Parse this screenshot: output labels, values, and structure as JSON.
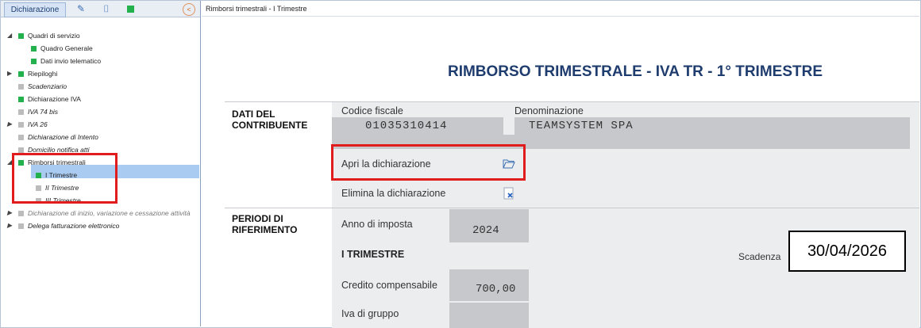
{
  "left_panel": {
    "tab_active": "Dichiarazione",
    "tree": [
      {
        "label": "Quadri di servizio"
      },
      {
        "label": "Quadro Generale"
      },
      {
        "label": "Dati invio telematico"
      },
      {
        "label": "Riepiloghi"
      },
      {
        "label": "Scadenziario"
      },
      {
        "label": "Dichiarazione IVA"
      },
      {
        "label": "IVA 74 bis"
      },
      {
        "label": "IVA 26"
      },
      {
        "label": "Dichiarazione di Intento"
      },
      {
        "label": "Domicilio notifica atti"
      },
      {
        "label": "Rimborsi trimestrali"
      },
      {
        "label": "I Trimestre"
      },
      {
        "label": "II Trimestre"
      },
      {
        "label": "III Trimestre"
      },
      {
        "label": "Dichiarazione di inizio, variazione e cessazione attività"
      },
      {
        "label": "Delega fatturazione elettronico"
      }
    ]
  },
  "breadcrumb": "Rimborsi trimestrali - I Trimestre",
  "title": "RIMBORSO TRIMESTRALE - IVA TR - 1° TRIMESTRE",
  "sections": {
    "contribuente": {
      "label_line1": "DATI DEL",
      "label_line2": "CONTRIBUENTE",
      "codice_fiscale_label": "Codice fiscale",
      "codice_fiscale_value": "01035310414",
      "denominazione_label": "Denominazione",
      "denominazione_value": "TEAMSYSTEM SPA",
      "apri_label": "Apri la dichiarazione",
      "elimina_label": "Elimina la dichiarazione"
    },
    "periodi": {
      "label_line1": "PERIODI DI",
      "label_line2": "RIFERIMENTO",
      "anno_label": "Anno di imposta",
      "anno_value": "2024",
      "trimestre_label": "I TRIMESTRE",
      "scadenza_label": "Scadenza",
      "scadenza_value": "30/04/2026",
      "credito_label": "Credito compensabile",
      "credito_value": "700,00",
      "iva_gruppo_label": "Iva di gruppo"
    }
  },
  "colors": {
    "accent": "#1f3c6e",
    "highlight": "#e01c1c",
    "green": "#22b14c"
  }
}
